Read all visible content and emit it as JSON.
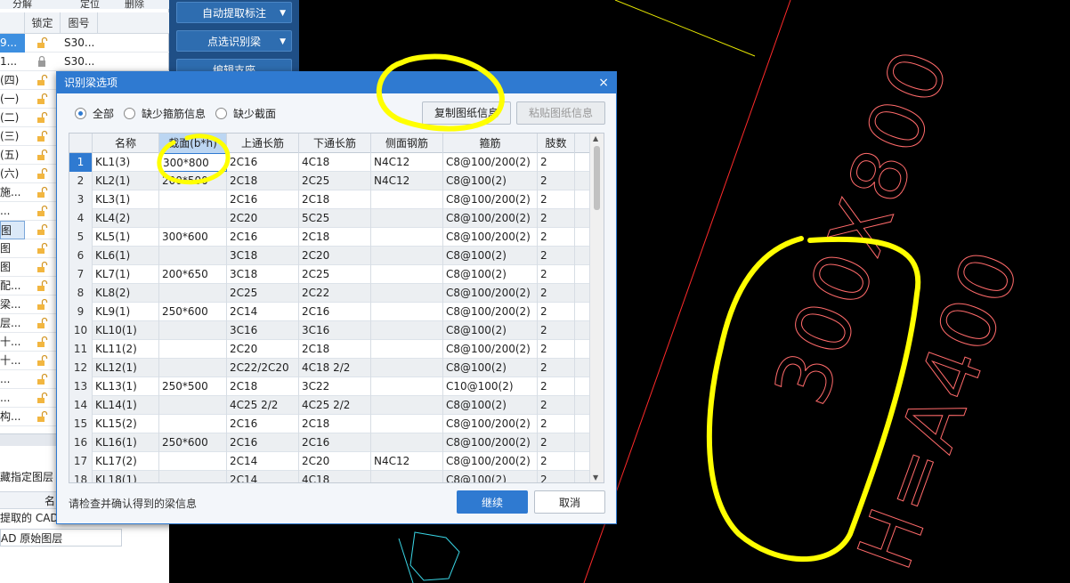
{
  "layer_panel": {
    "toolbar": [
      "分解",
      "定位",
      "删除"
    ],
    "headers": {
      "lock": "锁定",
      "drawing_no": "图号"
    },
    "rows": [
      {
        "name": "9...",
        "drawing_no": "S30...",
        "locked": false,
        "style": "sel"
      },
      {
        "name": "1...",
        "drawing_no": "S30...",
        "locked": true,
        "style": ""
      },
      {
        "name": "(四)",
        "drawing_no": "",
        "locked": false,
        "style": ""
      },
      {
        "name": "(一)",
        "drawing_no": "",
        "locked": false,
        "style": ""
      },
      {
        "name": "(二)",
        "drawing_no": "",
        "locked": false,
        "style": ""
      },
      {
        "name": "(三)",
        "drawing_no": "",
        "locked": false,
        "style": ""
      },
      {
        "name": "(五)",
        "drawing_no": "",
        "locked": false,
        "style": ""
      },
      {
        "name": "(六)",
        "drawing_no": "",
        "locked": false,
        "style": ""
      },
      {
        "name": "施...",
        "drawing_no": "",
        "locked": false,
        "style": ""
      },
      {
        "name": "...",
        "drawing_no": "",
        "locked": false,
        "style": ""
      },
      {
        "name": "图",
        "drawing_no": "",
        "locked": false,
        "style": "hl"
      },
      {
        "name": "图",
        "drawing_no": "",
        "locked": false,
        "style": ""
      },
      {
        "name": "图",
        "drawing_no": "",
        "locked": false,
        "style": ""
      },
      {
        "name": "配...",
        "drawing_no": "",
        "locked": false,
        "style": ""
      },
      {
        "name": "梁...",
        "drawing_no": "",
        "locked": false,
        "style": ""
      },
      {
        "name": "层...",
        "drawing_no": "",
        "locked": false,
        "style": ""
      },
      {
        "name": "十...",
        "drawing_no": "",
        "locked": false,
        "style": ""
      },
      {
        "name": "十...",
        "drawing_no": "",
        "locked": false,
        "style": ""
      },
      {
        "name": "...",
        "drawing_no": "",
        "locked": false,
        "style": ""
      },
      {
        "name": "...",
        "drawing_no": "",
        "locked": false,
        "style": ""
      },
      {
        "name": "构...",
        "drawing_no": "",
        "locked": false,
        "style": ""
      }
    ],
    "bottom": {
      "hint": "藏指定图层",
      "col_name": "名",
      "item1": "提取的 CAD",
      "item2": "AD 原始图层"
    }
  },
  "side_buttons": [
    "自动提取标注",
    "点选识别梁",
    "编辑支座"
  ],
  "dialog": {
    "title": "识别梁选项",
    "close": "×",
    "radios": [
      {
        "label": "全部",
        "checked": true
      },
      {
        "label": "缺少箍筋信息",
        "checked": false
      },
      {
        "label": "缺少截面",
        "checked": false
      }
    ],
    "copy_button": "复制图纸信息",
    "paste_button": "粘贴图纸信息",
    "columns": [
      "名称",
      "截面(b*h)",
      "上通长筋",
      "下通长筋",
      "侧面钢筋",
      "箍筋",
      "肢数"
    ],
    "rows": [
      {
        "no": "1",
        "name": "KL1(3)",
        "section": "300*800",
        "top": "2C16",
        "bottom": "4C18",
        "side": "N4C12",
        "stirrup": "C8@100/200(2)",
        "legs": "2"
      },
      {
        "no": "2",
        "name": "KL2(1)",
        "section": "200*500",
        "top": "2C18",
        "bottom": "2C25",
        "side": "N4C12",
        "stirrup": "C8@100(2)",
        "legs": "2"
      },
      {
        "no": "3",
        "name": "KL3(1)",
        "section": "",
        "top": "2C16",
        "bottom": "2C18",
        "side": "",
        "stirrup": "C8@100/200(2)",
        "legs": "2"
      },
      {
        "no": "4",
        "name": "KL4(2)",
        "section": "",
        "top": "2C20",
        "bottom": "5C25",
        "side": "",
        "stirrup": "C8@100/200(2)",
        "legs": "2"
      },
      {
        "no": "5",
        "name": "KL5(1)",
        "section": "300*600",
        "top": "2C16",
        "bottom": "2C18",
        "side": "",
        "stirrup": "C8@100/200(2)",
        "legs": "2"
      },
      {
        "no": "6",
        "name": "KL6(1)",
        "section": "",
        "top": "3C18",
        "bottom": "2C20",
        "side": "",
        "stirrup": "C8@100(2)",
        "legs": "2"
      },
      {
        "no": "7",
        "name": "KL7(1)",
        "section": "200*650",
        "top": "3C18",
        "bottom": "2C25",
        "side": "",
        "stirrup": "C8@100(2)",
        "legs": "2"
      },
      {
        "no": "8",
        "name": "KL8(2)",
        "section": "",
        "top": "2C25",
        "bottom": "2C22",
        "side": "",
        "stirrup": "C8@100/200(2)",
        "legs": "2"
      },
      {
        "no": "9",
        "name": "KL9(1)",
        "section": "250*600",
        "top": "2C14",
        "bottom": "2C16",
        "side": "",
        "stirrup": "C8@100/200(2)",
        "legs": "2"
      },
      {
        "no": "10",
        "name": "KL10(1)",
        "section": "",
        "top": "3C16",
        "bottom": "3C16",
        "side": "",
        "stirrup": "C8@100(2)",
        "legs": "2"
      },
      {
        "no": "11",
        "name": "KL11(2)",
        "section": "",
        "top": "2C20",
        "bottom": "2C18",
        "side": "",
        "stirrup": "C8@100/200(2)",
        "legs": "2"
      },
      {
        "no": "12",
        "name": "KL12(1)",
        "section": "",
        "top": "2C22/2C20",
        "bottom": "4C18 2/2",
        "side": "",
        "stirrup": "C8@100(2)",
        "legs": "2"
      },
      {
        "no": "13",
        "name": "KL13(1)",
        "section": "250*500",
        "top": "2C18",
        "bottom": "3C22",
        "side": "",
        "stirrup": "C10@100(2)",
        "legs": "2"
      },
      {
        "no": "14",
        "name": "KL14(1)",
        "section": "",
        "top": "4C25 2/2",
        "bottom": "4C25 2/2",
        "side": "",
        "stirrup": "C8@100(2)",
        "legs": "2"
      },
      {
        "no": "15",
        "name": "KL15(2)",
        "section": "",
        "top": "2C16",
        "bottom": "2C18",
        "side": "",
        "stirrup": "C8@100/200(2)",
        "legs": "2"
      },
      {
        "no": "16",
        "name": "KL16(1)",
        "section": "250*600",
        "top": "2C16",
        "bottom": "2C16",
        "side": "",
        "stirrup": "C8@100/200(2)",
        "legs": "2"
      },
      {
        "no": "17",
        "name": "KL17(2)",
        "section": "",
        "top": "2C14",
        "bottom": "2C20",
        "side": "N4C12",
        "stirrup": "C8@100/200(2)",
        "legs": "2"
      },
      {
        "no": "18",
        "name": "KL18(1)",
        "section": "",
        "top": "2C14",
        "bottom": "4C18",
        "side": "",
        "stirrup": "C8@100(2)",
        "legs": "2"
      }
    ],
    "status": "请检查并确认得到的梁信息",
    "continue_button": "继续",
    "cancel_button": "取消"
  },
  "canvas": {
    "text_section": "300X800",
    "text_stirrup": "H=A400",
    "annotation_color": "#ffff00",
    "text_color": "#ff6666"
  }
}
